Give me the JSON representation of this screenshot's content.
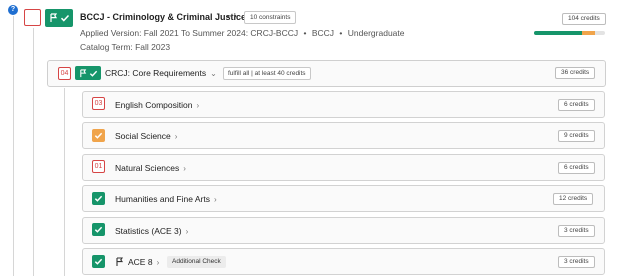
{
  "program": {
    "title": "BCCJ - Criminology & Criminal Justice",
    "constraints_label": "10 constraints",
    "applied_version": "Applied Version: Fall 2021 To Summer 2024: CRCJ-BCCJ",
    "code": "BCCJ",
    "level": "Undergraduate",
    "separator": "•",
    "catalog_term": "Catalog Term: Fall 2023",
    "credits": "104 credits",
    "progress": {
      "completed_fraction": 0.68,
      "in_progress_fraction": 0.18
    },
    "colors": {
      "complete": "#16956a",
      "in_progress": "#f0a44b",
      "incomplete": "#d64545"
    }
  },
  "group": {
    "count": "04",
    "title": "CRCJ: Core Requirements",
    "rule": "fulfill all | at least 40 credits",
    "credits": "36 credits"
  },
  "requirements": [
    {
      "name": "English Composition",
      "status": "incomplete",
      "count": "03",
      "credits": "6 credits"
    },
    {
      "name": "Social Science",
      "status": "in-progress",
      "credits": "9 credits"
    },
    {
      "name": "Natural Sciences",
      "status": "incomplete",
      "count": "01",
      "credits": "6 credits"
    },
    {
      "name": "Humanities and Fine Arts",
      "status": "complete",
      "credits": "12 credits"
    },
    {
      "name": "Statistics (ACE 3)",
      "status": "complete",
      "credits": "3 credits"
    },
    {
      "name": "ACE 8",
      "status": "complete",
      "credits": "3 credits",
      "tag": "Additional Check"
    }
  ],
  "icons": {
    "info": "info-icon",
    "flag": "flag-icon",
    "check": "check-icon",
    "more": "more-icon",
    "chevron": "chevron-icon"
  }
}
